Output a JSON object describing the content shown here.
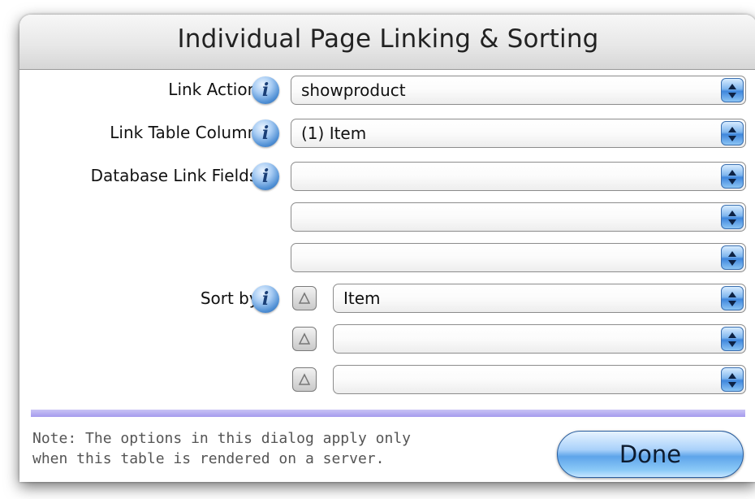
{
  "dialog": {
    "title": "Individual Page Linking & Sorting"
  },
  "fields": {
    "link_action": {
      "label": "Link Action:",
      "value": "showproduct"
    },
    "link_table_column": {
      "label": "Link Table Column:",
      "value": "(1) Item"
    },
    "database_link_fields": {
      "label": "Database Link Fields:",
      "values": [
        "",
        "",
        ""
      ]
    },
    "sort_by": {
      "label": "Sort by:",
      "values": [
        "Item",
        "",
        ""
      ]
    }
  },
  "footer": {
    "note": "Note: The options in this dialog apply only when this table is rendered on a server.",
    "note_line1": "Note: The options in this dialog apply only",
    "note_line2": "when this table is rendered on a server.",
    "done_label": "Done"
  },
  "icons": {
    "info": "info-icon",
    "stepper": "updown-arrows-icon",
    "sort_direction": "triangle-up-icon"
  },
  "colors": {
    "accent_blue": "#5ea4ea",
    "separator": "#a59bee"
  }
}
